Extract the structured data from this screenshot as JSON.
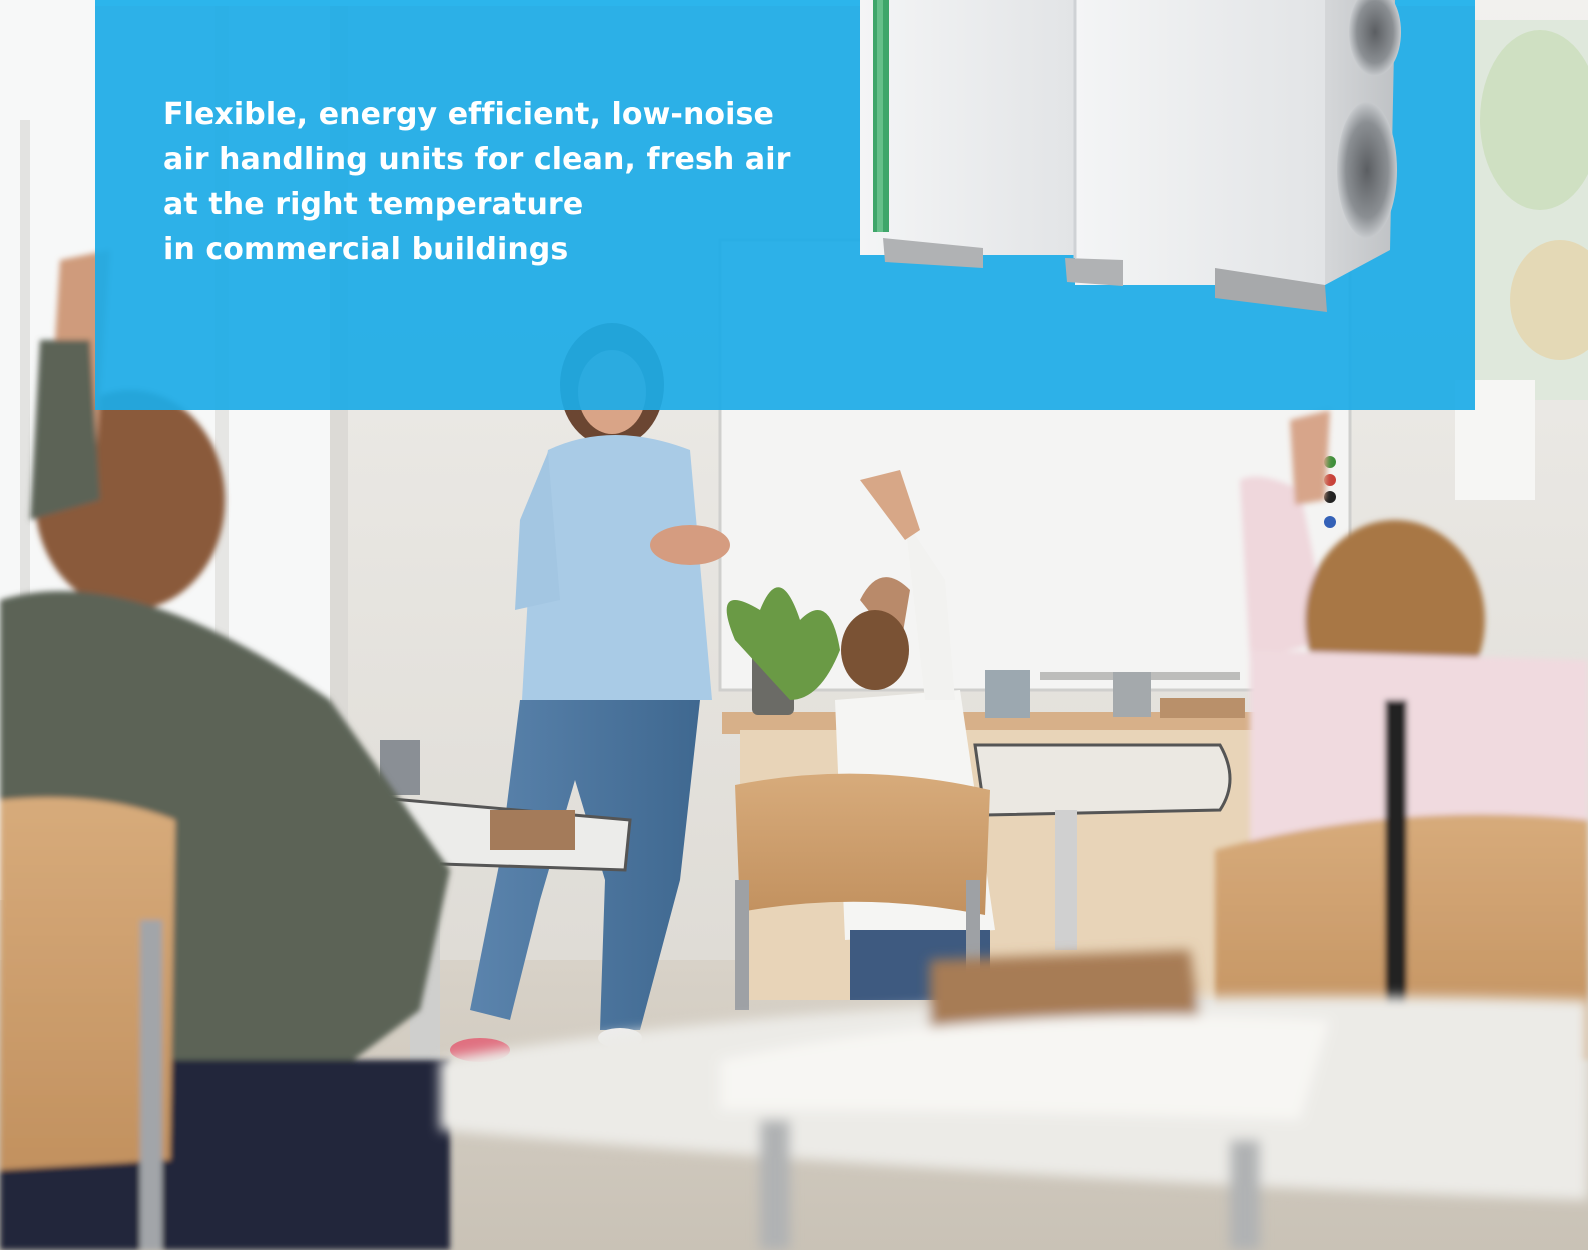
{
  "banner": {
    "headline_lines": [
      "Flexible, energy efficient, low-noise",
      "air handling units for clean, fresh air",
      "at the right temperature",
      "in commercial buildings"
    ],
    "color": "#1dabe6"
  },
  "product_image": {
    "icon": "air-handling-unit-image"
  },
  "photo": {
    "description_icon": "classroom-photo"
  }
}
